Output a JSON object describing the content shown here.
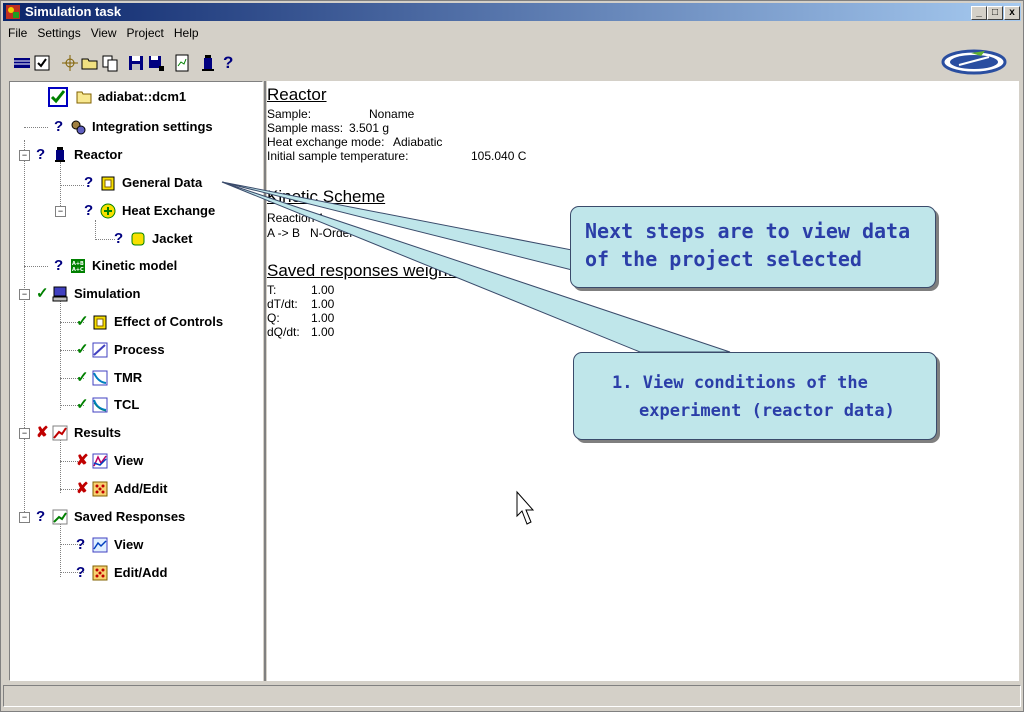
{
  "window": {
    "title": "Simulation task",
    "min": "_",
    "max": "□",
    "close": "x"
  },
  "menu": [
    "File",
    "Settings",
    "View",
    "Project",
    "Help"
  ],
  "tree": {
    "root": "adiabat::dcm1",
    "items": [
      {
        "label": "Integration settings",
        "status": "?"
      },
      {
        "label": "Reactor",
        "status": "?"
      },
      {
        "label": "General Data",
        "status": "?"
      },
      {
        "label": "Heat Exchange",
        "status": "?"
      },
      {
        "label": "Jacket",
        "status": "?"
      },
      {
        "label": "Kinetic model",
        "status": "?"
      },
      {
        "label": "Simulation",
        "status": "✓"
      },
      {
        "label": "Effect of Controls",
        "status": "✓"
      },
      {
        "label": "Process",
        "status": "✓"
      },
      {
        "label": "TMR",
        "status": "✓"
      },
      {
        "label": "TCL",
        "status": "✓"
      },
      {
        "label": "Results",
        "status": "✘"
      },
      {
        "label": "View",
        "status": "✘"
      },
      {
        "label": "Add/Edit",
        "status": "✘"
      },
      {
        "label": "Saved Responses",
        "status": "?"
      },
      {
        "label": "View",
        "status": "?"
      },
      {
        "label": "Edit/Add",
        "status": "?"
      }
    ]
  },
  "reactor": {
    "heading": "Reactor",
    "sample_label": "Sample:",
    "sample_value": "Noname",
    "mass_label": "Sample mass:",
    "mass_value": "3.501 g",
    "heat_label": "Heat exchange mode:",
    "heat_value": "Adiabatic",
    "temp_label": "Initial sample temperature:",
    "temp_value": "105.040 C"
  },
  "kinetic": {
    "heading": "Kinetic Scheme",
    "reaction_label": "Reaction 1",
    "reaction_value": "A -> B   N-Order"
  },
  "saved": {
    "heading": "Saved responses weights",
    "rows": [
      {
        "k": "T:",
        "v": "1.00"
      },
      {
        "k": "dT/dt:",
        "v": "1.00"
      },
      {
        "k": "Q:",
        "v": "1.00"
      },
      {
        "k": "dQ/dt:",
        "v": "1.00"
      }
    ]
  },
  "callouts": {
    "next": "Next steps are to view data of the project selected",
    "next_line1": "Next steps are to view data",
    "next_line2": "of the project selected",
    "step1_line1": "1. View conditions of the",
    "step1_line2": "experiment (reactor data)"
  }
}
